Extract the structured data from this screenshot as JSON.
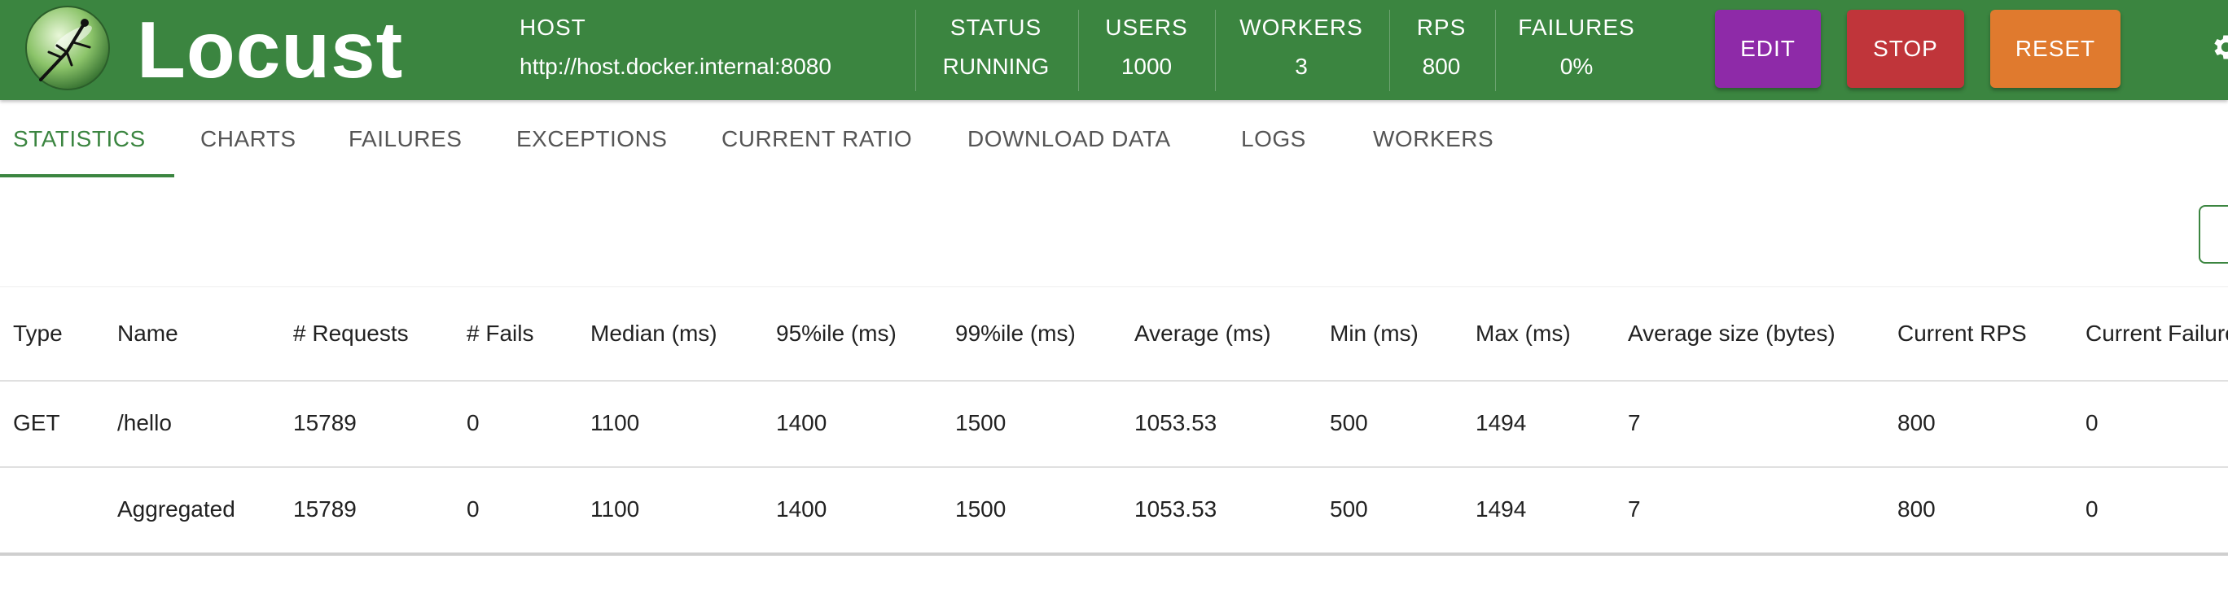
{
  "app": {
    "name": "Locust"
  },
  "header": {
    "host": {
      "label": "HOST",
      "value": "http://host.docker.internal:8080"
    },
    "status": {
      "label": "STATUS",
      "value": "RUNNING"
    },
    "users": {
      "label": "USERS",
      "value": "1000"
    },
    "workers": {
      "label": "WORKERS",
      "value": "3"
    },
    "rps": {
      "label": "RPS",
      "value": "800"
    },
    "failures": {
      "label": "FAILURES",
      "value": "0%"
    },
    "buttons": {
      "edit": "EDIT",
      "stop": "STOP",
      "reset": "RESET"
    }
  },
  "tabs": [
    "STATISTICS",
    "CHARTS",
    "FAILURES",
    "EXCEPTIONS",
    "CURRENT RATIO",
    "DOWNLOAD DATA",
    "LOGS",
    "WORKERS"
  ],
  "table": {
    "columns": [
      "Type",
      "Name",
      "# Requests",
      "# Fails",
      "Median (ms)",
      "95%ile (ms)",
      "99%ile (ms)",
      "Average (ms)",
      "Min (ms)",
      "Max (ms)",
      "Average size (bytes)",
      "Current RPS",
      "Current Failures/s"
    ],
    "rows": [
      [
        "GET",
        "/hello",
        "15789",
        "0",
        "1100",
        "1400",
        "1500",
        "1053.53",
        "500",
        "1494",
        "7",
        "800",
        "0"
      ],
      [
        "",
        "Aggregated",
        "15789",
        "0",
        "1100",
        "1400",
        "1500",
        "1053.53",
        "500",
        "1494",
        "7",
        "800",
        "0"
      ]
    ]
  },
  "colors": {
    "header_bg": "#3b8540",
    "edit_button": "#8e2aa8",
    "stop_button": "#c0353a",
    "reset_button": "#e07a2e",
    "active_tab": "#3b8540"
  },
  "icons": {
    "logo": "locust-logo-icon",
    "settings": "gear-icon"
  }
}
